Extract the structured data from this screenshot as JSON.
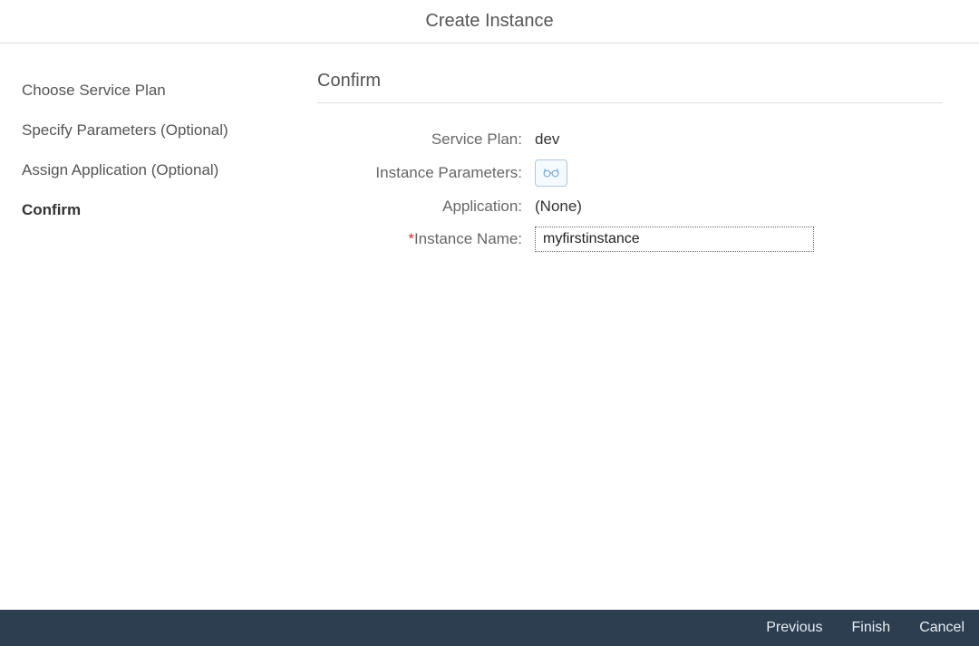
{
  "header": {
    "title": "Create Instance"
  },
  "sidebar": {
    "items": [
      {
        "label": "Choose Service Plan",
        "active": false
      },
      {
        "label": "Specify Parameters (Optional)",
        "active": false
      },
      {
        "label": "Assign Application (Optional)",
        "active": false
      },
      {
        "label": "Confirm",
        "active": true
      }
    ]
  },
  "main": {
    "section_title": "Confirm",
    "fields": {
      "service_plan": {
        "label": "Service Plan:",
        "value": "dev"
      },
      "instance_parameters": {
        "label": "Instance Parameters:"
      },
      "application": {
        "label": "Application:",
        "value": "(None)"
      },
      "instance_name": {
        "label": "Instance Name:",
        "value": "myfirstinstance",
        "required": "*"
      }
    }
  },
  "footer": {
    "previous": "Previous",
    "finish": "Finish",
    "cancel": "Cancel"
  }
}
